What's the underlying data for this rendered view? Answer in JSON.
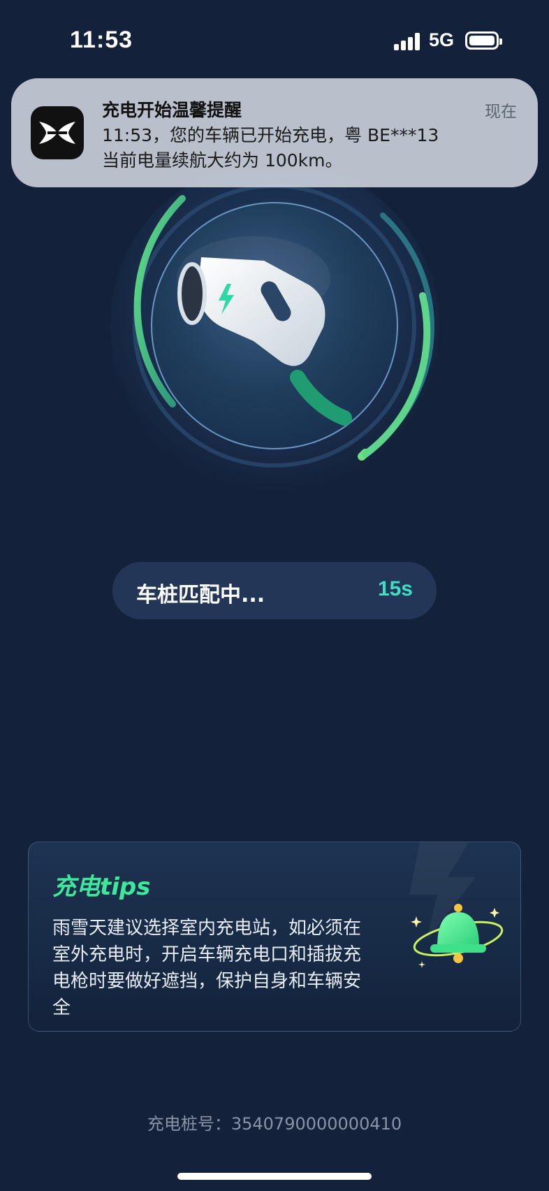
{
  "status_bar": {
    "time": "11:53",
    "network": "5G",
    "battery_level": 1.0
  },
  "notification": {
    "title": "充电开始温馨提醒",
    "time_label": "现在",
    "line1": "11:53，您的车辆已开始充电，粤 BE***13",
    "line2": "当前电量续航大约为 100km。"
  },
  "charging_visual": {
    "icon": "charging-plug-icon",
    "accent_color": "#3ee89a"
  },
  "match_status": {
    "label": "车桩匹配中...",
    "countdown": "15s"
  },
  "tips": {
    "title": "充电tips",
    "lines": [
      "雨雪天建议选择室内充电站，如必须在",
      "室外充电时，开启车辆充电口和插拔充",
      "电枪时要做好遮挡，保护自身和车辆安",
      "全"
    ],
    "icon": "bell-icon"
  },
  "pile_id": "充电桩号：3540790000000410"
}
